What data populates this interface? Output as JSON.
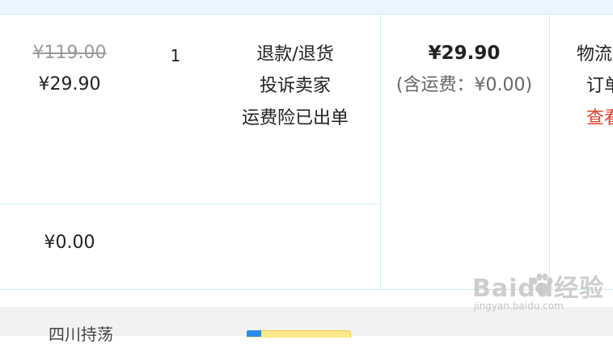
{
  "order": {
    "original_price": "¥119.00",
    "unit_price": "¥29.90",
    "quantity": "1",
    "actions": {
      "refund": "退款/退货",
      "complain": "投诉卖家",
      "insurance": "运费险已出单"
    },
    "subtotal_price": "¥29.90",
    "shipping_note": "(含运费：¥0.00)",
    "logistics": {
      "label": "物流",
      "order_label": "订单",
      "view_label": "查看"
    },
    "discount_amount": "¥0.00"
  },
  "footer": {
    "partial_label": "四川持荡"
  },
  "watermark": {
    "text": "Baidu经验",
    "url": "jingyan.baidu.com"
  }
}
